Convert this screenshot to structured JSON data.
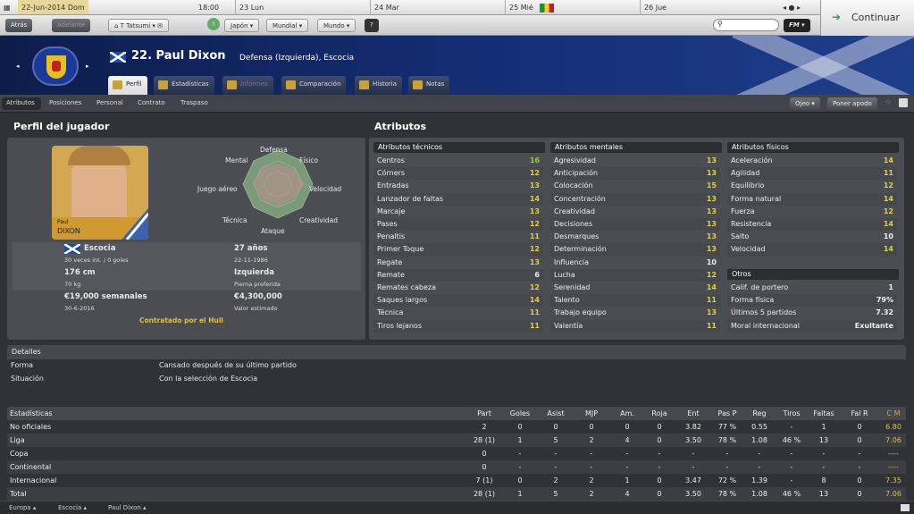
{
  "calendar": {
    "date": "22-Jun-2014",
    "day": "Dom",
    "time": "18:00",
    "days": [
      {
        "label": "23 Lun"
      },
      {
        "label": "24 Mar"
      },
      {
        "label": "25 Mié"
      },
      {
        "label": "26 Jue"
      }
    ]
  },
  "continue_label": "Continuar",
  "nav": {
    "back": "Atrás",
    "forward": "Adelante",
    "manager": "T Tatsumi",
    "country": "Japón",
    "world_cup": "Mundial",
    "world": "Mundo",
    "help": "?",
    "fm": "FM"
  },
  "player": {
    "title": "22. Paul Dixon",
    "subtitle": "Defensa (Izquierda), Escocia",
    "firstname": "Paul",
    "lastname": "DIXON"
  },
  "tabs": [
    "Perfil",
    "Estadísticas",
    "Informes",
    "Comparación",
    "Historia",
    "Notas"
  ],
  "subnav": [
    "Atributos",
    "Posiciones",
    "Personal",
    "Contrato",
    "Traspaso"
  ],
  "subnav_right": {
    "scout": "Ojeo",
    "support": "Poner apodo"
  },
  "profile": {
    "title": "Perfil del jugador",
    "radar_labels": [
      "Defensa",
      "Físico",
      "Velocidad",
      "Creatividad",
      "Ataque",
      "Técnica",
      "Juego aéreo",
      "Mental"
    ],
    "nationality": "Escocia",
    "caps": "30 veces int. / 0 goles",
    "age": "27 años",
    "dob": "22-11-1986",
    "height": "176 cm",
    "weight": "70 kg",
    "foot": "Izquierda",
    "foot_label": "Pierna preferida",
    "wage": "€19,000 semanales",
    "contract": "30-6-2016",
    "value": "€4,300,000",
    "value_label": "Valor estimado",
    "contracted": "Contratado por el Hull"
  },
  "attributes": {
    "title": "Atributos",
    "technical_title": "Atributos técnicos",
    "technical": [
      [
        "Centros",
        "16",
        "g"
      ],
      [
        "Córners",
        "12",
        "y"
      ],
      [
        "Entradas",
        "13",
        "y"
      ],
      [
        "Lanzador de faltas",
        "14",
        "y"
      ],
      [
        "Marcaje",
        "13",
        "y"
      ],
      [
        "Pases",
        "12",
        "y"
      ],
      [
        "Penaltis",
        "11",
        "y"
      ],
      [
        "Primer Toque",
        "12",
        "y"
      ],
      [
        "Regate",
        "13",
        "y"
      ],
      [
        "Remate",
        "6",
        "w"
      ],
      [
        "Remates cabeza",
        "12",
        "y"
      ],
      [
        "Saques largos",
        "14",
        "y"
      ],
      [
        "Técnica",
        "11",
        "y"
      ],
      [
        "Tiros lejanos",
        "11",
        "y"
      ]
    ],
    "mental_title": "Atributos mentales",
    "mental": [
      [
        "Agresividad",
        "13",
        "y"
      ],
      [
        "Anticipación",
        "13",
        "y"
      ],
      [
        "Colocación",
        "15",
        "y"
      ],
      [
        "Concentración",
        "13",
        "y"
      ],
      [
        "Creatividad",
        "13",
        "y"
      ],
      [
        "Decisiones",
        "13",
        "y"
      ],
      [
        "Desmarques",
        "13",
        "y"
      ],
      [
        "Determinación",
        "13",
        "y"
      ],
      [
        "Influencia",
        "10",
        "w"
      ],
      [
        "Lucha",
        "12",
        "y"
      ],
      [
        "Serenidad",
        "14",
        "y"
      ],
      [
        "Talento",
        "11",
        "y"
      ],
      [
        "Trabajo equipo",
        "13",
        "y"
      ],
      [
        "Valentía",
        "11",
        "y"
      ]
    ],
    "physical_title": "Atributos físicos",
    "physical": [
      [
        "Aceleración",
        "14",
        "y"
      ],
      [
        "Agilidad",
        "11",
        "y"
      ],
      [
        "Equilibrio",
        "12",
        "y"
      ],
      [
        "Forma natural",
        "14",
        "y"
      ],
      [
        "Fuerza",
        "12",
        "y"
      ],
      [
        "Resistencia",
        "14",
        "y"
      ],
      [
        "Salto",
        "10",
        "w"
      ],
      [
        "Velocidad",
        "14",
        "y"
      ]
    ],
    "other_title": "Otros",
    "other": [
      [
        "Calif. de portero",
        "1",
        "w"
      ],
      [
        "Forma física",
        "79%",
        "w"
      ],
      [
        "Últimos 5 partidos",
        "7.32",
        "w"
      ],
      [
        "Moral internacional",
        "Exultante",
        "w"
      ]
    ]
  },
  "details": {
    "title": "Detalles",
    "rows": [
      [
        "Forma",
        "Cansado después de su último partido"
      ],
      [
        "Situación",
        "Con la selección de Escocia"
      ]
    ]
  },
  "stats": {
    "title": "Estadísticas",
    "columns": [
      "Part",
      "Goles",
      "Asist",
      "MJP",
      "Am.",
      "Roja",
      "Ent",
      "Pas P",
      "Reg",
      "Tiros",
      "Faltas",
      "Fal R",
      "C M"
    ],
    "rows": [
      [
        "No oficiales",
        "2",
        "0",
        "0",
        "0",
        "0",
        "0",
        "3.82",
        "77 %",
        "0.55",
        "-",
        "1",
        "0",
        "6.80"
      ],
      [
        "Liga",
        "28 (1)",
        "1",
        "5",
        "2",
        "4",
        "0",
        "3.50",
        "78 %",
        "1.08",
        "46 %",
        "13",
        "0",
        "7.06"
      ],
      [
        "Copa",
        "0",
        "-",
        "-",
        "-",
        "-",
        "-",
        "-",
        "-",
        "-",
        "-",
        "-",
        "-",
        "----"
      ],
      [
        "Continental",
        "0",
        "-",
        "-",
        "-",
        "-",
        "-",
        "-",
        "-",
        "-",
        "-",
        "-",
        "-",
        "----"
      ],
      [
        "Internacional",
        "7 (1)",
        "0",
        "2",
        "2",
        "1",
        "0",
        "3.47",
        "72 %",
        "1.39",
        "-",
        "8",
        "0",
        "7.35"
      ],
      [
        "Total",
        "28 (1)",
        "1",
        "5",
        "2",
        "4",
        "0",
        "3.50",
        "78 %",
        "1.08",
        "46 %",
        "13",
        "0",
        "7.06"
      ]
    ]
  },
  "footer": [
    "Europa",
    "Escocia",
    "Paul Dixon"
  ]
}
